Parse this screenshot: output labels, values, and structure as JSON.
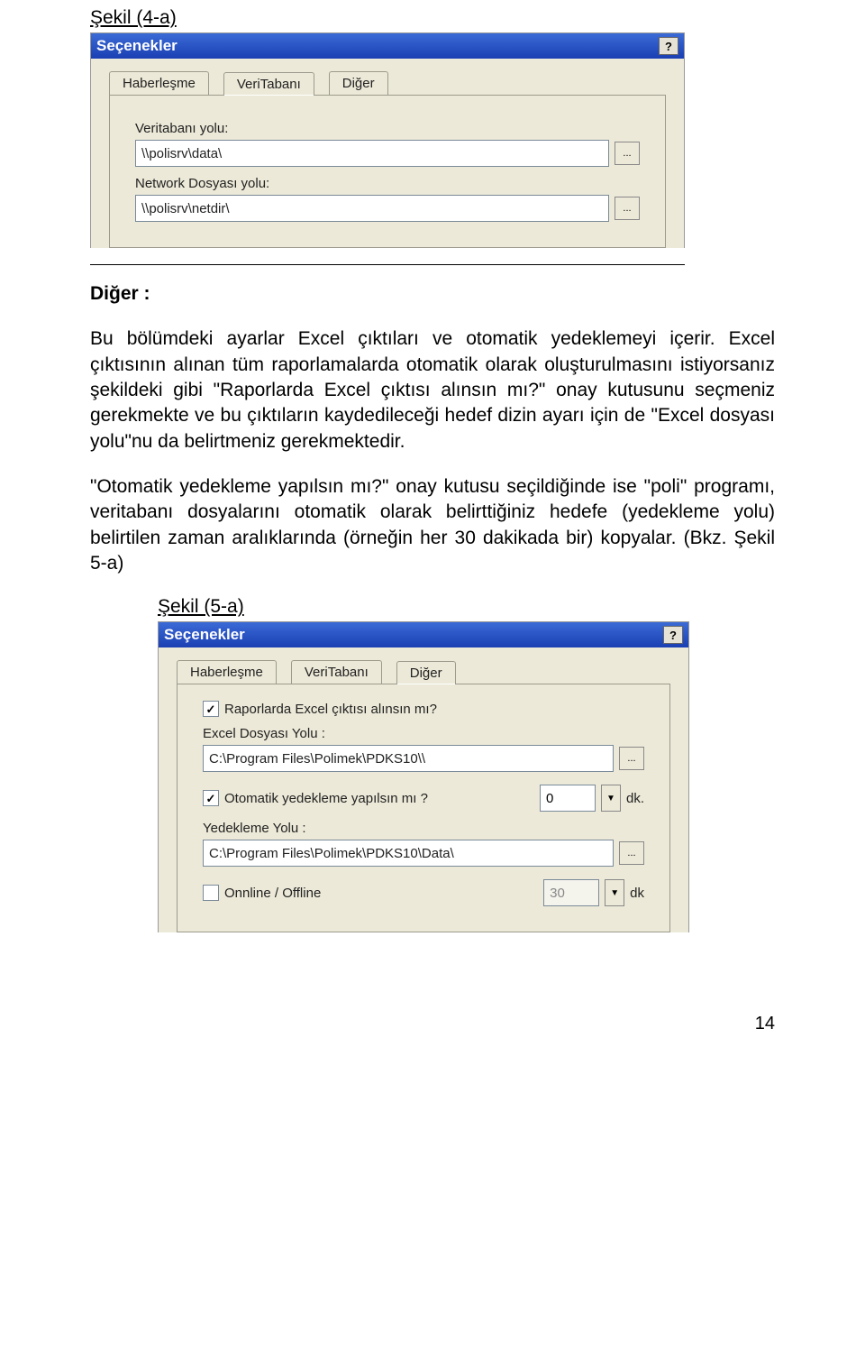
{
  "fig4a": {
    "label": "Şekil (4-a)",
    "window": {
      "title": "Seçenekler",
      "tabs": [
        "Haberleşme",
        "VeriTabanı",
        "Diğer"
      ],
      "active_tab": 1,
      "db_path_label": "Veritabanı yolu:",
      "db_path_value": "\\\\polisrv\\data\\",
      "net_path_label": "Network Dosyası yolu:",
      "net_path_value": "\\\\polisrv\\netdir\\"
    }
  },
  "body": {
    "h_diger": "Diğer :",
    "p1": "Bu bölümdeki ayarlar Excel çıktıları ve otomatik yedeklemeyi içerir. Excel çıktısının alınan tüm raporlamalarda otomatik olarak oluşturulmasını istiyorsanız şekildeki gibi \"Raporlarda Excel çıktısı alınsın mı?\" onay kutusunu seçmeniz gerekmekte ve bu çıktıların kaydedileceği hedef dizin ayarı için de \"Excel dosyası yolu\"nu da belirtmeniz gerekmektedir.",
    "p2": "\"Otomatik yedekleme yapılsın mı?\" onay kutusu seçildiğinde ise \"poli\" programı, veritabanı dosyalarını otomatik olarak belirttiğiniz hedefe (yedekleme yolu) belirtilen zaman aralıklarında (örneğin her 30 dakikada bir) kopyalar. (Bkz. Şekil 5-a)"
  },
  "fig5a": {
    "label": "Şekil (5-a)",
    "window": {
      "title": "Seçenekler",
      "tabs": [
        "Haberleşme",
        "VeriTabanı",
        "Diğer"
      ],
      "active_tab": 2,
      "chk_excel": "Raporlarda Excel çıktısı alınsın mı?",
      "excel_path_label": "Excel Dosyası Yolu :",
      "excel_path_value": "C:\\Program Files\\Polimek\\PDKS10\\\\",
      "chk_backup": "Otomatik yedekleme yapılsın mı ?",
      "backup_interval_value": "0",
      "dk": "dk.",
      "backup_path_label": "Yedekleme Yolu  :",
      "backup_path_value": "C:\\Program Files\\Polimek\\PDKS10\\Data\\",
      "chk_online": "Onnline / Offline",
      "online_value": "30",
      "dk2": "dk"
    }
  },
  "pagenum": "14",
  "glyph": {
    "help": "?",
    "browse": "...",
    "check": "✓",
    "down": "▼"
  }
}
